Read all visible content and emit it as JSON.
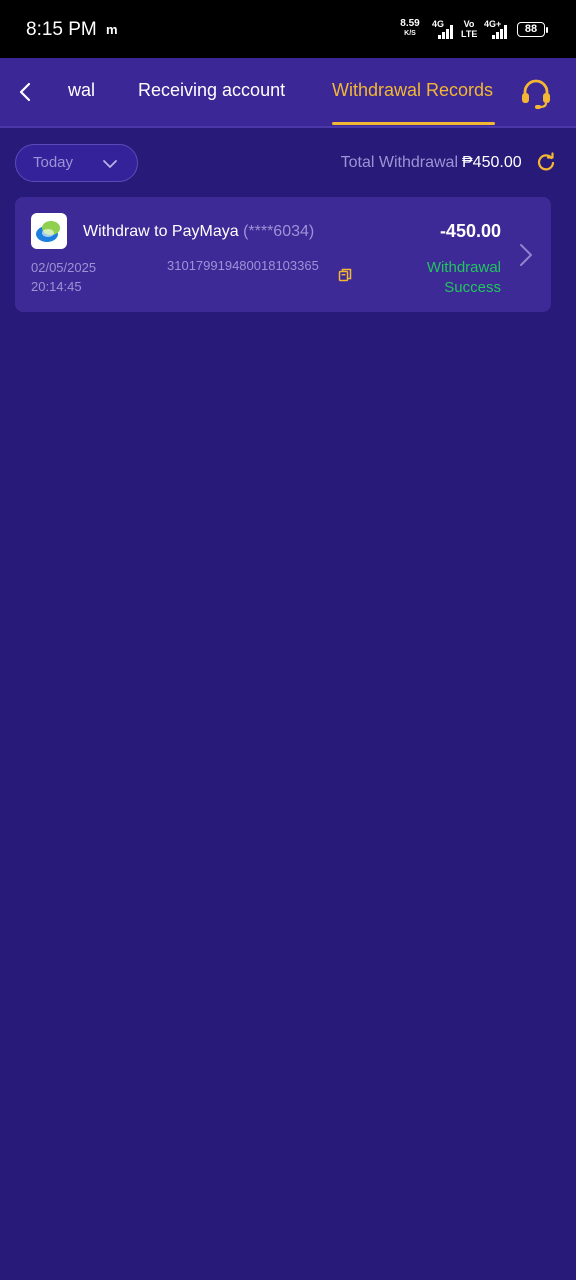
{
  "status_bar": {
    "time": "8:15 PM",
    "notification": "m",
    "speed_value": "8.59",
    "speed_unit": "K/S",
    "net1": "4G",
    "net2_top": "Vo",
    "net2_bottom": "LTE",
    "net3": "4G+",
    "battery": "88"
  },
  "header": {
    "tabs": [
      {
        "label": "wal"
      },
      {
        "label": "Receiving account"
      },
      {
        "label": "Withdrawal Records"
      }
    ],
    "active_tab_index": 2,
    "accent_color": "#f3b733"
  },
  "filter": {
    "date_value": "Today",
    "total_label": "Total Withdrawal",
    "total_amount": "₱450.00"
  },
  "records": [
    {
      "title": "Withdraw to PayMaya",
      "account": "(****6034)",
      "amount": "-450.00",
      "date": "02/05/2025",
      "time": "20:14:45",
      "order_no": "310179919480018103365",
      "status_line1": "Withdrawal",
      "status_line2": "Success",
      "status_color": "#22c55e"
    }
  ]
}
